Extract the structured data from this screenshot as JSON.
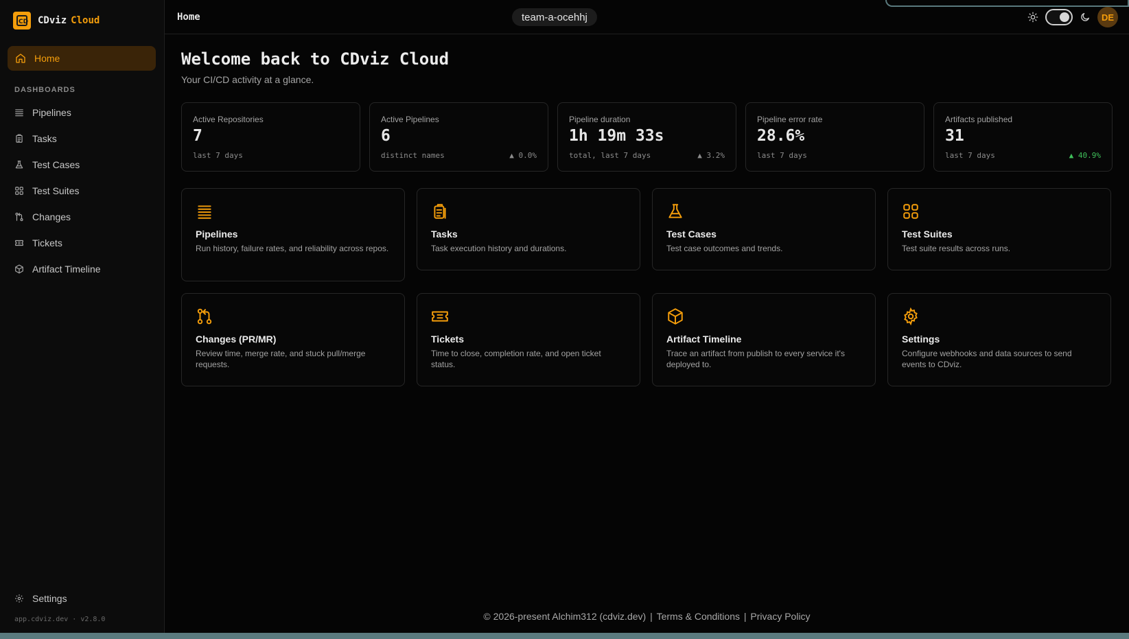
{
  "brand": {
    "name": "CDviz",
    "accent": "Cloud",
    "color": "#f59e0b"
  },
  "sidebar": {
    "home_label": "Home",
    "section_label": "DASHBOARDS",
    "items": [
      {
        "label": "Pipelines",
        "icon": "list-icon"
      },
      {
        "label": "Tasks",
        "icon": "clipboard-icon"
      },
      {
        "label": "Test Cases",
        "icon": "flask-icon"
      },
      {
        "label": "Test Suites",
        "icon": "grid-icon"
      },
      {
        "label": "Changes",
        "icon": "git-pull-request-icon"
      },
      {
        "label": "Tickets",
        "icon": "ticket-icon"
      },
      {
        "label": "Artifact Timeline",
        "icon": "package-icon"
      }
    ],
    "settings_label": "Settings",
    "version": "app.cdviz.dev · v2.8.0"
  },
  "header": {
    "breadcrumb": "Home",
    "team": "team-a-ocehhj",
    "avatar_initials": "DE"
  },
  "main": {
    "title": "Welcome back to CDviz Cloud",
    "subtitle": "Your CI/CD activity at a glance."
  },
  "stats": [
    {
      "label": "Active Repositories",
      "value": "7",
      "foot": "last 7 days",
      "delta": ""
    },
    {
      "label": "Active Pipelines",
      "value": "6",
      "foot": "distinct names",
      "delta": "▲ 0.0%"
    },
    {
      "label": "Pipeline duration",
      "value": "1h 19m 33s",
      "foot": "total, last 7 days",
      "delta": "▲ 3.2%"
    },
    {
      "label": "Pipeline error rate",
      "value": "28.6%",
      "foot": "last 7 days",
      "delta": ""
    },
    {
      "label": "Artifacts published",
      "value": "31",
      "foot": "last 7 days",
      "delta": "▲ 40.9%"
    }
  ],
  "cards": [
    {
      "title": "Pipelines",
      "desc": "Run history, failure rates, and reliability across repos.",
      "icon": "list-icon"
    },
    {
      "title": "Tasks",
      "desc": "Task execution history and durations.",
      "icon": "clipboard-icon"
    },
    {
      "title": "Test Cases",
      "desc": "Test case outcomes and trends.",
      "icon": "flask-icon"
    },
    {
      "title": "Test Suites",
      "desc": "Test suite results across runs.",
      "icon": "grid-icon"
    },
    {
      "title": "Changes (PR/MR)",
      "desc": "Review time, merge rate, and stuck pull/merge requests.",
      "icon": "git-pull-request-icon"
    },
    {
      "title": "Tickets",
      "desc": "Time to close, completion rate, and open ticket status.",
      "icon": "ticket-icon"
    },
    {
      "title": "Artifact Timeline",
      "desc": "Trace an artifact from publish to every service it's deployed to.",
      "icon": "package-icon"
    },
    {
      "title": "Settings",
      "desc": "Configure webhooks and data sources to send events to CDviz.",
      "icon": "gear-icon"
    }
  ],
  "footer": {
    "copyright": "© 2026-present Alchim312 (cdviz.dev)",
    "terms": "Terms & Conditions",
    "privacy": "Privacy Policy"
  }
}
